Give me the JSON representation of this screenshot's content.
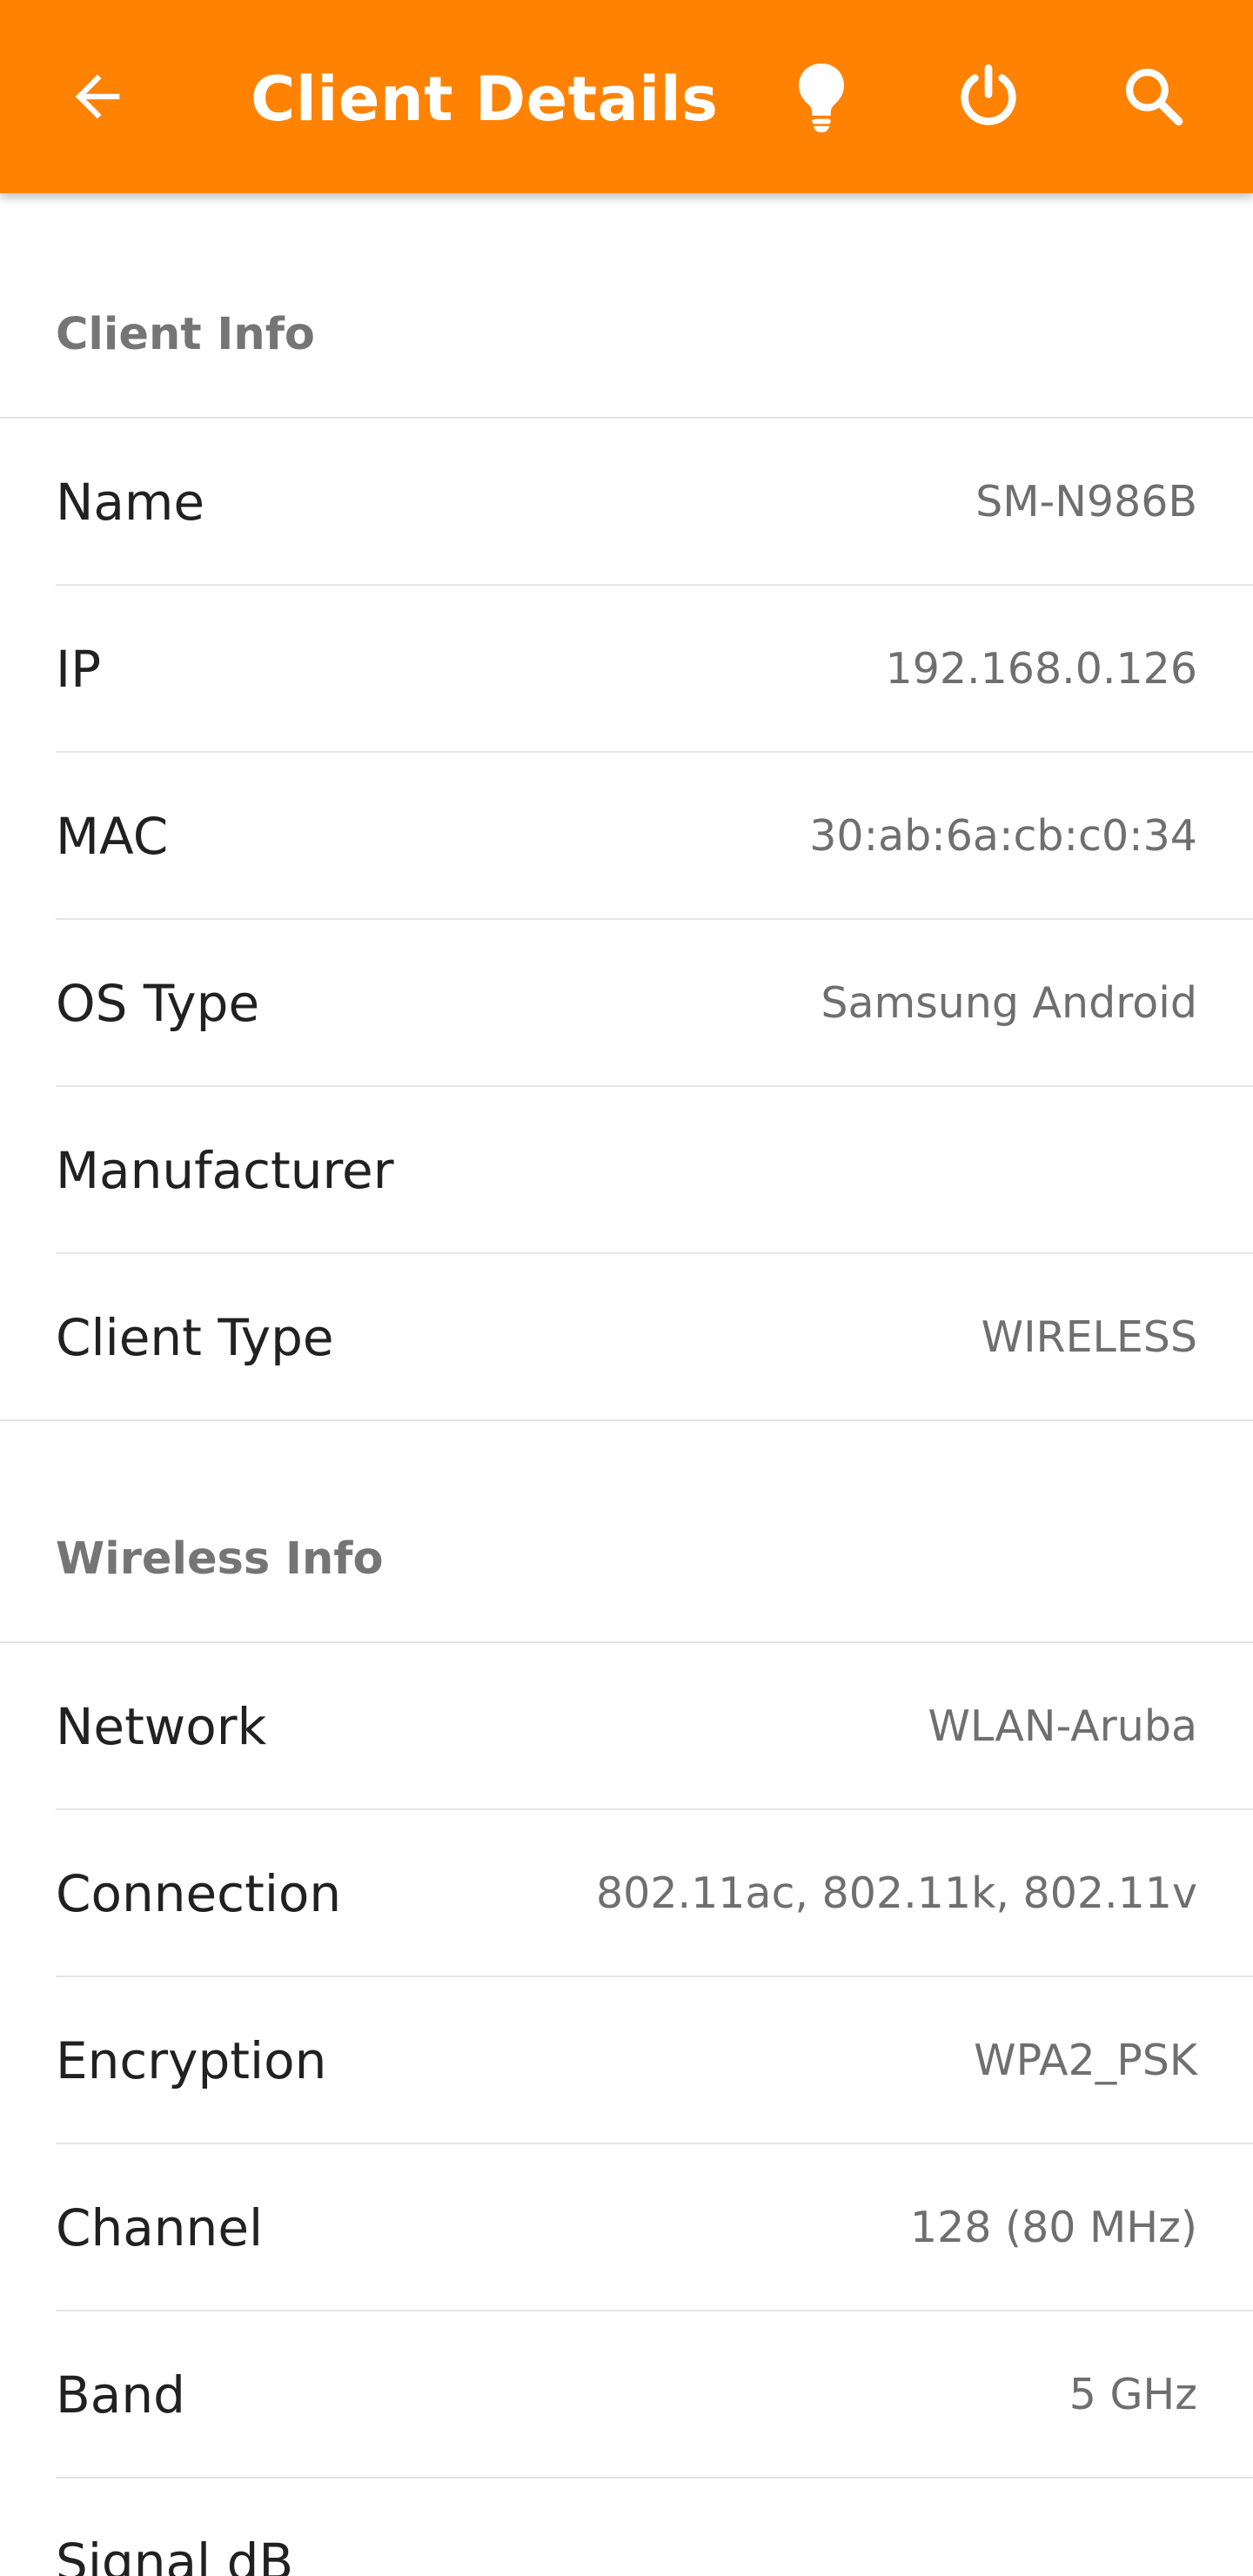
{
  "header": {
    "title": "Client Details",
    "background_color": "#ff8203",
    "icons": [
      "arrow-back-icon",
      "lightbulb-icon",
      "power-icon",
      "search-icon"
    ]
  },
  "client_info": {
    "title": "Client Info",
    "rows": [
      {
        "label": "Name",
        "value": "SM-N986B"
      },
      {
        "label": "IP",
        "value": "192.168.0.126"
      },
      {
        "label": "MAC",
        "value": "30:ab:6a:cb:c0:34"
      },
      {
        "label": "OS Type",
        "value": "Samsung Android"
      },
      {
        "label": "Manufacturer",
        "value": ""
      },
      {
        "label": "Client Type",
        "value": "WIRELESS"
      }
    ]
  },
  "wireless_info": {
    "title": "Wireless Info",
    "rows": [
      {
        "label": "Network",
        "value": "WLAN-Aruba"
      },
      {
        "label": "Connection",
        "value": "802.11ac, 802.11k, 802.11v"
      },
      {
        "label": "Encryption",
        "value": "WPA2_PSK"
      },
      {
        "label": "Channel",
        "value": "128 (80 MHz)"
      },
      {
        "label": "Band",
        "value": "5 GHz"
      },
      {
        "label": "Signal dB",
        "value": ""
      }
    ]
  }
}
